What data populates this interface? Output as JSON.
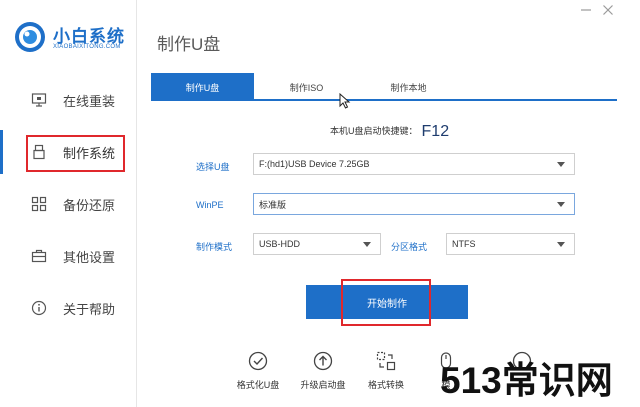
{
  "app": {
    "logo_title": "小白系统",
    "logo_subtitle": "XIAOBAIXITONG.COM",
    "page_title": "制作U盘"
  },
  "sidebar": {
    "items": [
      {
        "label": "在线重装",
        "icon": "monitor-icon"
      },
      {
        "label": "制作系统",
        "icon": "usb-drive-icon",
        "active": true
      },
      {
        "label": "备份还原",
        "icon": "grid-icon"
      },
      {
        "label": "其他设置",
        "icon": "toolbox-icon"
      },
      {
        "label": "关于帮助",
        "icon": "info-icon"
      }
    ]
  },
  "tabs": [
    {
      "label": "制作U盘",
      "active": true
    },
    {
      "label": "制作ISO"
    },
    {
      "label": "制作本地"
    }
  ],
  "hotkey": {
    "label": "本机U盘启动快捷键：",
    "key": "F12"
  },
  "form": {
    "usb_label": "选择U盘",
    "usb_value": "F:(hd1)USB Device 7.25GB",
    "winpe_label": "WinPE",
    "winpe_value": "标准版",
    "mode_label": "制作模式",
    "mode_value": "USB-HDD",
    "partition_label": "分区格式",
    "partition_value": "NTFS"
  },
  "start_button": "开始制作",
  "tools": [
    {
      "label": "格式化U盘",
      "icon": "check-circle-icon"
    },
    {
      "label": "升级启动盘",
      "icon": "upload-circle-icon"
    },
    {
      "label": "格式转换",
      "icon": "convert-icon"
    },
    {
      "label": "模",
      "icon": "mouse-icon"
    },
    {
      "label": "",
      "icon": "partial-icon"
    }
  ],
  "watermark": "513常识网",
  "colors": {
    "accent": "#1e6fc8",
    "highlight": "#e0282c"
  }
}
